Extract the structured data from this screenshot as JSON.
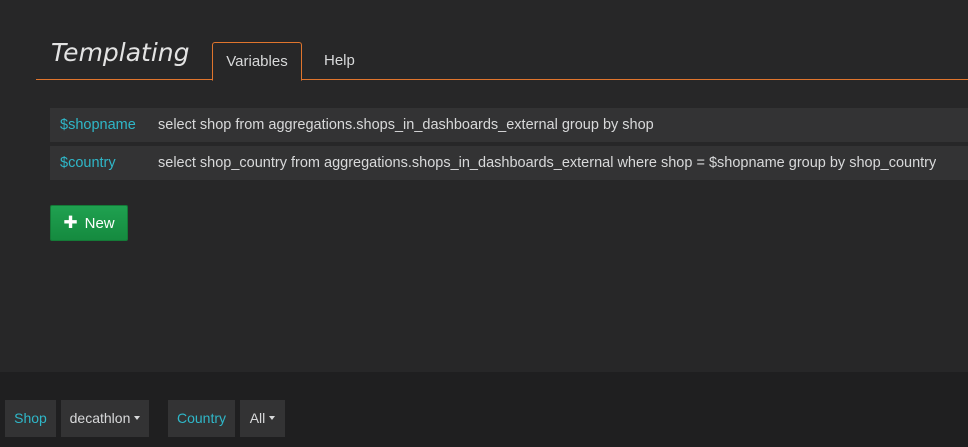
{
  "header": {
    "title": "Templating",
    "tabs": [
      {
        "label": "Variables",
        "active": true
      },
      {
        "label": "Help",
        "active": false
      }
    ]
  },
  "variables": [
    {
      "name": "$shopname",
      "query": "select shop from aggregations.shops_in_dashboards_external group by shop"
    },
    {
      "name": "$country",
      "query": "select shop_country from aggregations.shops_in_dashboards_external where shop = $shopname group by shop_country"
    }
  ],
  "new_button": {
    "label": "New",
    "icon": "plus-icon"
  },
  "submenu": {
    "shop": {
      "label": "Shop",
      "value": "decathlon"
    },
    "country": {
      "label": "Country",
      "value": "All"
    }
  },
  "colors": {
    "accent": "#e0752d",
    "variable_name": "#2fb7c8",
    "new_button": "#1a9a4a"
  }
}
